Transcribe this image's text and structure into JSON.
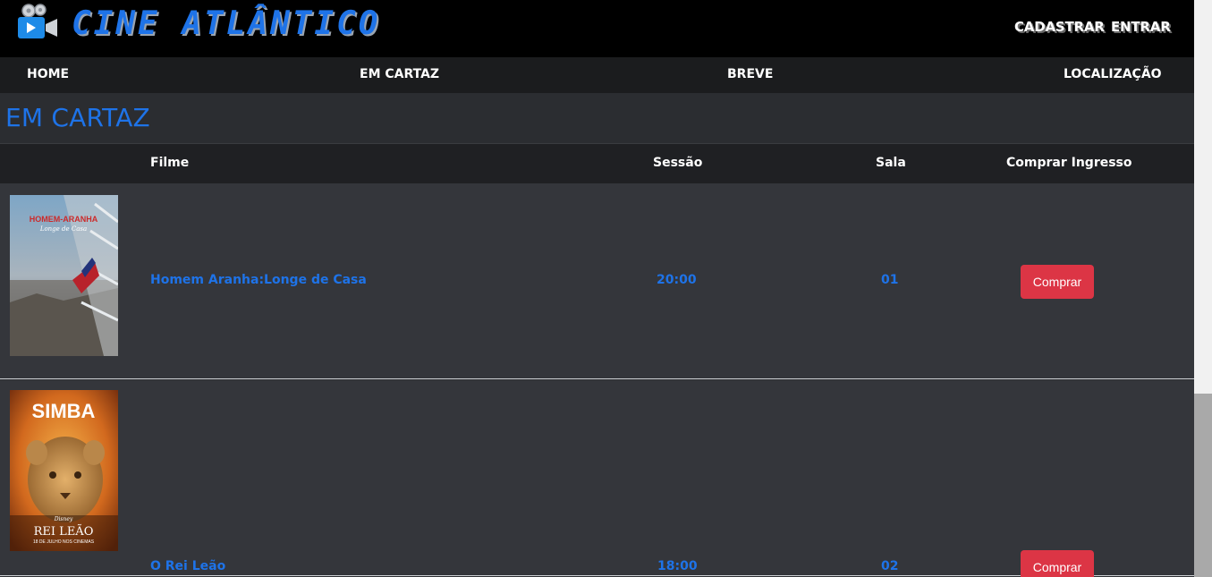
{
  "brand": {
    "name": "CINE ATLÂNTICO",
    "logo_icon": "movie-camera-icon",
    "accent": "#1e73e8"
  },
  "auth": {
    "register_label": "CADASTRAR",
    "login_label": "ENTRAR"
  },
  "nav": {
    "items": [
      {
        "label": "HOME"
      },
      {
        "label": "EM CARTAZ"
      },
      {
        "label": "BREVE"
      },
      {
        "label": "LOCALIZAÇÃO"
      }
    ]
  },
  "main": {
    "title": "EM CARTAZ",
    "columns": {
      "film": "Filme",
      "session": "Sessão",
      "room": "Sala",
      "buy": "Comprar Ingresso"
    },
    "movies": [
      {
        "title": "Homem Aranha:Longe de Casa",
        "session": "20:00",
        "room": "01",
        "buy_label": "Comprar",
        "poster": {
          "heading": "HOMEM-ARANHA",
          "subtitle": "Longe de Casa"
        }
      },
      {
        "title": "O Rei Leão",
        "session": "18:00",
        "room": "02",
        "buy_label": "Comprar",
        "poster": {
          "heading": "SIMBA",
          "brand": "Disney",
          "subtitle": "REI LEÃO",
          "caption": "18 DE JULHO NOS CINEMAS"
        }
      }
    ]
  },
  "colors": {
    "buy_button": "#dc3545",
    "link_text": "#1e73e8",
    "row_bg": "#34363b"
  }
}
